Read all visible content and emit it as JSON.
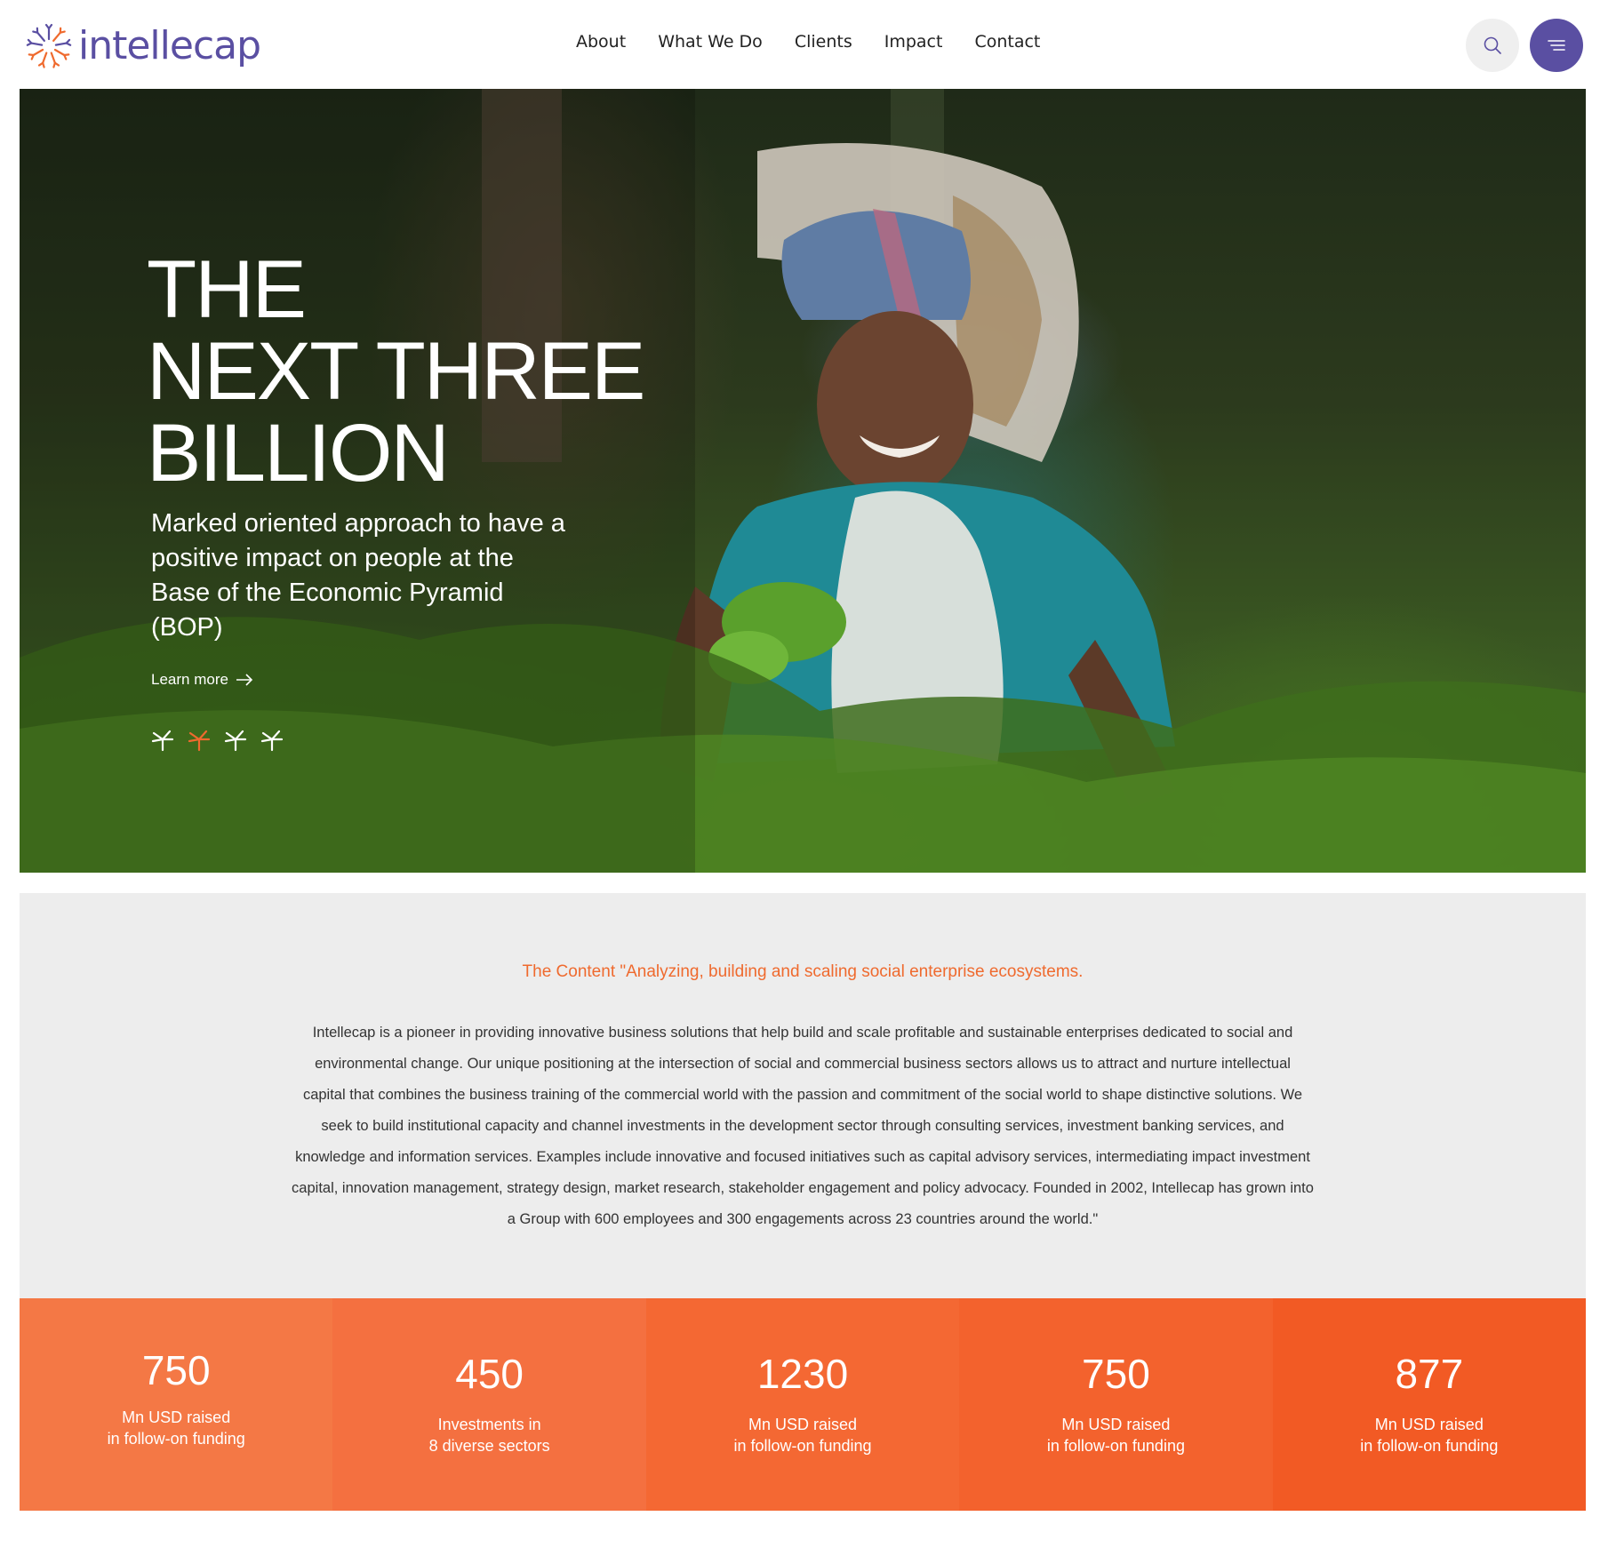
{
  "brand": {
    "name": "intellecap",
    "color": "#5a4fa2",
    "accent": "#ef6a2e"
  },
  "nav": {
    "items": [
      "About",
      "What We Do",
      "Clients",
      "Impact",
      "Contact"
    ]
  },
  "header_icons": {
    "search": "search-icon",
    "menu": "menu-icon"
  },
  "hero": {
    "title_lines": [
      "THE",
      "NEXT THREE",
      "BILLION"
    ],
    "subtitle": "Marked oriented approach to have a positive impact on people at the Base of the Economic Pyramid (BOP)",
    "learn_more": "Learn more",
    "slides_total": 4,
    "active_slide": 2
  },
  "content": {
    "heading": "The Content \"Analyzing, building and scaling social enterprise ecosystems.",
    "body": "Intellecap is a pioneer in providing innovative business solutions that help build and scale profitable and sustainable enterprises dedicated to social and environmental change. Our unique positioning at the intersection of social and commercial business sectors allows us to attract and nurture intellectual capital that combines the business training of the commercial world with the passion and commitment of the social world to shape distinctive solutions. We seek to build institutional capacity and channel investments in the development sector through consulting services, investment banking services, and knowledge and information services. Examples include innovative and focused initiatives such as capital advisory services, intermediating impact investment capital, innovation management, strategy design, market research, stakeholder engagement and policy advocacy. Founded in 2002, Intellecap has grown into a Group with 600 employees and 300 engagements across 23 countries around the world.\""
  },
  "stats": [
    {
      "value": "750",
      "label_line1": "Mn USD raised",
      "label_line2": "in follow-on funding",
      "color": "#f47845"
    },
    {
      "value": "450",
      "label_line1": "Investments in",
      "label_line2": "8 diverse sectors",
      "color": "#f47040"
    },
    {
      "value": "1230",
      "label_line1": "Mn USD raised",
      "label_line2": "in follow-on funding",
      "color": "#f46833"
    },
    {
      "value": "750",
      "label_line1": "Mn USD raised",
      "label_line2": "in follow-on funding",
      "color": "#f3622d"
    },
    {
      "value": "877",
      "label_line1": "Mn USD raised",
      "label_line2": "in follow-on funding",
      "color": "#f25a24"
    }
  ]
}
